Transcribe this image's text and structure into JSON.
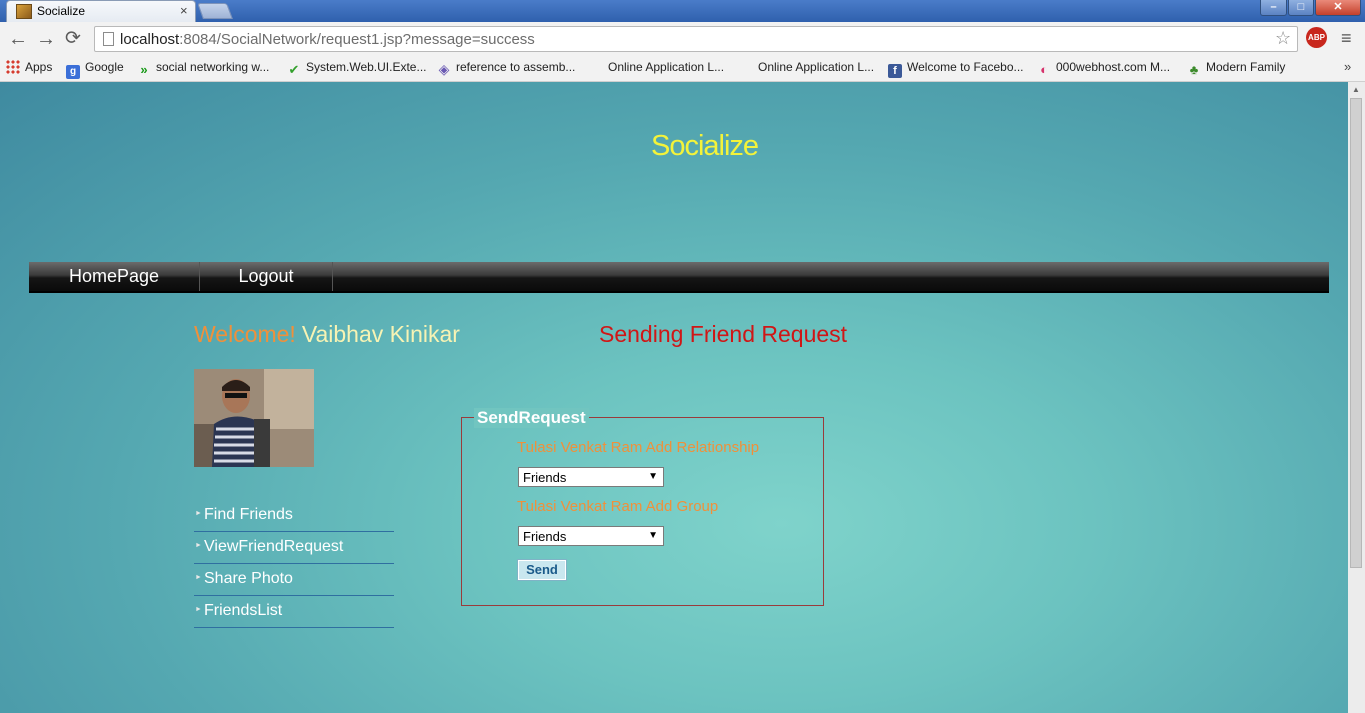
{
  "browser": {
    "tab_title": "Socialize",
    "tab_close": "×",
    "url_host": "localhost",
    "url_rest": ":8084/SocialNetwork/request1.jsp?message=success",
    "abp_label": "ABP",
    "window_controls": {
      "minimize": "–",
      "maximize": "□",
      "close": "✕"
    },
    "nav_icons": {
      "back": "←",
      "forward": "→",
      "reload": "⟳",
      "star": "☆",
      "menu": "≡"
    },
    "bookmarks": [
      {
        "label": "Apps",
        "icon": "apps-grid-icon"
      },
      {
        "label": "Google",
        "icon": "google-icon"
      },
      {
        "label": "social networking w...",
        "icon": "chevron-icon"
      },
      {
        "label": "System.Web.UI.Exte...",
        "icon": "check-icon"
      },
      {
        "label": "reference to assemb...",
        "icon": "visual-studio-icon"
      },
      {
        "label": "Online Application L...",
        "icon": ""
      },
      {
        "label": "Online Application L...",
        "icon": ""
      },
      {
        "label": "Welcome to Facebo...",
        "icon": "facebook-icon"
      },
      {
        "label": "000webhost.com M...",
        "icon": "webhost-icon"
      },
      {
        "label": "Modern Family",
        "icon": "leaf-icon"
      }
    ],
    "bookmarks_more": "»"
  },
  "site": {
    "title": "Socialize",
    "nav": {
      "home": "HomePage",
      "logout": "Logout"
    },
    "welcome_label": "Welcome!",
    "user_name": "Vaibhav Kinikar",
    "page_heading": "Sending Friend Request",
    "side_menu": [
      "Find Friends",
      "ViewFriendRequest",
      "Share Photo",
      "FriendsList"
    ],
    "form": {
      "legend": "SendRequest",
      "relationship_label": "Tulasi Venkat Ram Add Relationship",
      "relationship_value": "Friends",
      "group_label": "Tulasi Venkat Ram Add Group",
      "group_value": "Friends",
      "submit_label": "Send"
    }
  },
  "colors": {
    "site_title": "#f3f33a",
    "welcome": "#f0903a",
    "user_name": "#f7f3b4",
    "heading": "#d01616",
    "fieldset_border": "#9a3b3b"
  }
}
